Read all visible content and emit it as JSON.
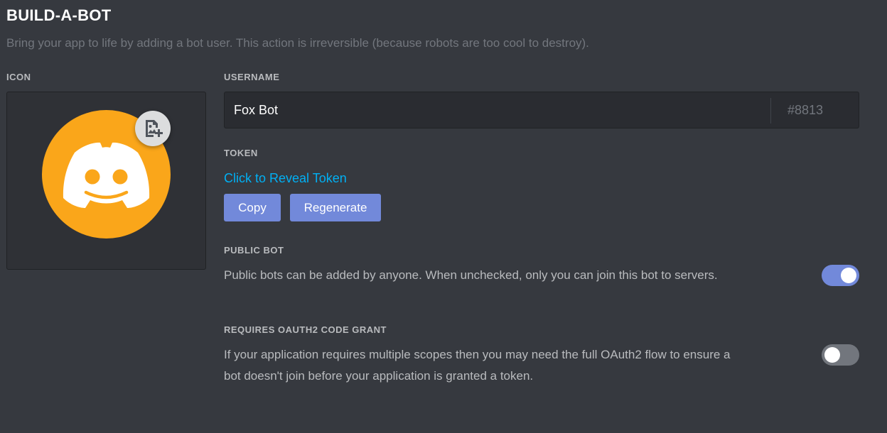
{
  "header": {
    "title": "BUILD-A-BOT",
    "subtitle": "Bring your app to life by adding a bot user. This action is irreversible (because robots are too cool to destroy)."
  },
  "icon_section": {
    "label": "ICON",
    "avatar_icon": "discord-logo-icon",
    "avatar_color": "#faa61a",
    "upload_icon": "image-add-icon"
  },
  "username": {
    "label": "USERNAME",
    "value": "Fox Bot",
    "discriminator": "#8813"
  },
  "token": {
    "label": "TOKEN",
    "reveal_text": "Click to Reveal Token",
    "copy_label": "Copy",
    "regenerate_label": "Regenerate"
  },
  "public_bot": {
    "label": "PUBLIC BOT",
    "description": "Public bots can be added by anyone. When unchecked, only you can join this bot to servers.",
    "enabled": true
  },
  "oauth2": {
    "label": "REQUIRES OAUTH2 CODE GRANT",
    "description_line1": "If your application requires multiple scopes then you may need the full OAuth2 flow to ensure a",
    "description_line2": "bot doesn't join before your application is granted a token.",
    "enabled": false
  },
  "colors": {
    "background": "#36393f",
    "accent": "#7289da",
    "link": "#00b0f4",
    "avatar": "#faa61a"
  }
}
